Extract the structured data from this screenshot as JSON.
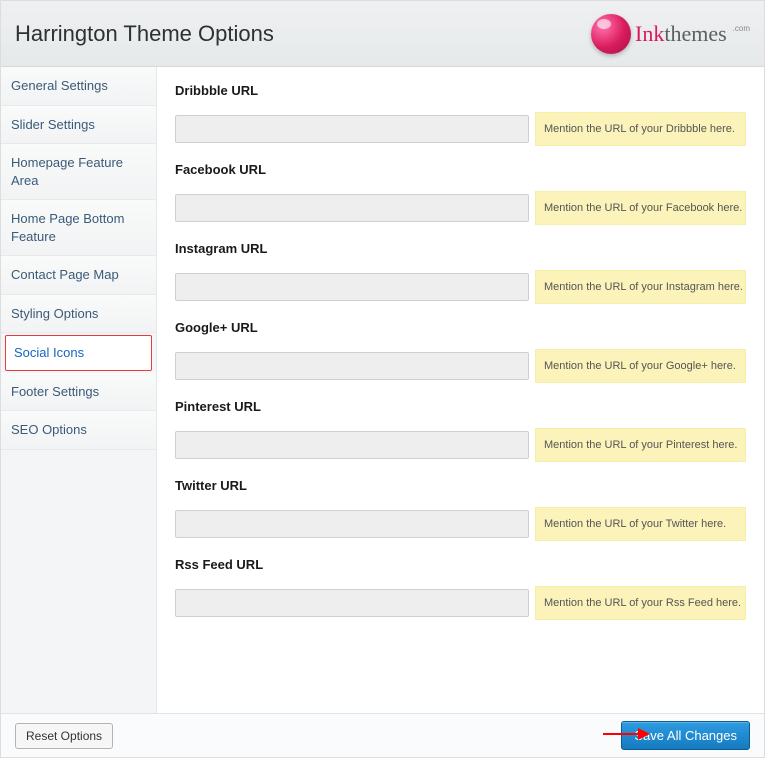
{
  "header": {
    "title": "Harrington Theme Options",
    "logo_ink": "Ink",
    "logo_themes": "themes",
    "logo_com": ".com"
  },
  "sidebar": {
    "items": [
      {
        "label": "General Settings"
      },
      {
        "label": "Slider Settings"
      },
      {
        "label": "Homepage Feature Area"
      },
      {
        "label": "Home Page Bottom Feature"
      },
      {
        "label": "Contact Page Map"
      },
      {
        "label": "Styling Options"
      },
      {
        "label": "Social Icons"
      },
      {
        "label": "Footer Settings"
      },
      {
        "label": "SEO Options"
      }
    ],
    "active_index": 6
  },
  "fields": [
    {
      "label": "Dribbble URL",
      "value": "",
      "hint": "Mention the URL of your Dribbble here."
    },
    {
      "label": "Facebook URL",
      "value": "",
      "hint": "Mention the URL of your Facebook here."
    },
    {
      "label": "Instagram URL",
      "value": "",
      "hint": "Mention the URL of your Instagram here."
    },
    {
      "label": "Google+ URL",
      "value": "",
      "hint": "Mention the URL of your Google+ here."
    },
    {
      "label": "Pinterest URL",
      "value": "",
      "hint": "Mention the URL of your Pinterest here."
    },
    {
      "label": "Twitter URL",
      "value": "",
      "hint": "Mention the URL of your Twitter here."
    },
    {
      "label": "Rss Feed URL",
      "value": "",
      "hint": "Mention the URL of your Rss Feed here."
    }
  ],
  "footer": {
    "reset": "Reset Options",
    "save": "Save All Changes"
  }
}
